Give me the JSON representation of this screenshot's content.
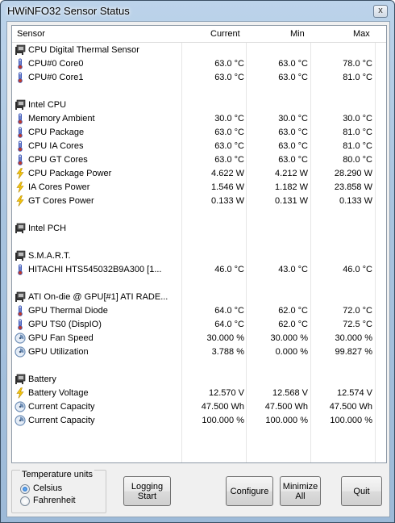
{
  "window": {
    "title": "HWiNFO32 Sensor Status",
    "close_label": "x"
  },
  "columns": {
    "sensor": "Sensor",
    "current": "Current",
    "min": "Min",
    "max": "Max"
  },
  "rows": [
    {
      "kind": "group",
      "label": "CPU Digital Thermal Sensor",
      "icon": "chip-icon"
    },
    {
      "kind": "sensor",
      "label": "CPU#0 Core0",
      "current": "63.0 °C",
      "min": "63.0 °C",
      "max": "78.0 °C",
      "icon": "thermometer-icon"
    },
    {
      "kind": "sensor",
      "label": "CPU#0 Core1",
      "current": "63.0 °C",
      "min": "63.0 °C",
      "max": "81.0 °C",
      "icon": "thermometer-icon"
    },
    {
      "kind": "blank"
    },
    {
      "kind": "group",
      "label": "Intel CPU",
      "icon": "chip-icon"
    },
    {
      "kind": "sensor",
      "label": "Memory Ambient",
      "current": "30.0 °C",
      "min": "30.0 °C",
      "max": "30.0 °C",
      "icon": "thermometer-icon"
    },
    {
      "kind": "sensor",
      "label": "CPU Package",
      "current": "63.0 °C",
      "min": "63.0 °C",
      "max": "81.0 °C",
      "icon": "thermometer-icon"
    },
    {
      "kind": "sensor",
      "label": "CPU IA Cores",
      "current": "63.0 °C",
      "min": "63.0 °C",
      "max": "81.0 °C",
      "icon": "thermometer-icon"
    },
    {
      "kind": "sensor",
      "label": "CPU GT Cores",
      "current": "63.0 °C",
      "min": "63.0 °C",
      "max": "80.0 °C",
      "icon": "thermometer-icon"
    },
    {
      "kind": "sensor",
      "label": "CPU Package Power",
      "current": "4.622 W",
      "min": "4.212 W",
      "max": "28.290 W",
      "icon": "lightning-icon"
    },
    {
      "kind": "sensor",
      "label": "IA Cores Power",
      "current": "1.546 W",
      "min": "1.182 W",
      "max": "23.858 W",
      "icon": "lightning-icon"
    },
    {
      "kind": "sensor",
      "label": "GT Cores Power",
      "current": "0.133 W",
      "min": "0.131 W",
      "max": "0.133 W",
      "icon": "lightning-icon"
    },
    {
      "kind": "blank"
    },
    {
      "kind": "group",
      "label": "Intel PCH",
      "icon": "chip-icon"
    },
    {
      "kind": "blank"
    },
    {
      "kind": "group",
      "label": "S.M.A.R.T.",
      "icon": "chip-icon"
    },
    {
      "kind": "sensor",
      "label": "HITACHI HTS545032B9A300 [1...",
      "current": "46.0 °C",
      "min": "43.0 °C",
      "max": "46.0 °C",
      "icon": "thermometer-icon"
    },
    {
      "kind": "blank"
    },
    {
      "kind": "group",
      "label": "ATI On-die @ GPU[#1] ATI RADE...",
      "icon": "chip-icon"
    },
    {
      "kind": "sensor",
      "label": "GPU Thermal Diode",
      "current": "64.0 °C",
      "min": "62.0 °C",
      "max": "72.0 °C",
      "icon": "thermometer-icon"
    },
    {
      "kind": "sensor",
      "label": "GPU TS0 (DispIO)",
      "current": "64.0 °C",
      "min": "62.0 °C",
      "max": "72.5 °C",
      "icon": "thermometer-icon"
    },
    {
      "kind": "sensor",
      "label": "GPU Fan Speed",
      "current": "30.000 %",
      "min": "30.000 %",
      "max": "30.000 %",
      "icon": "gauge-icon"
    },
    {
      "kind": "sensor",
      "label": "GPU Utilization",
      "current": "3.788 %",
      "min": "0.000 %",
      "max": "99.827 %",
      "icon": "gauge-icon"
    },
    {
      "kind": "blank"
    },
    {
      "kind": "group",
      "label": "Battery",
      "icon": "chip-icon"
    },
    {
      "kind": "sensor",
      "label": "Battery Voltage",
      "current": "12.570 V",
      "min": "12.568 V",
      "max": "12.574 V",
      "icon": "lightning-icon"
    },
    {
      "kind": "sensor",
      "label": "Current Capacity",
      "current": "47.500 Wh",
      "min": "47.500 Wh",
      "max": "47.500 Wh",
      "icon": "gauge-icon"
    },
    {
      "kind": "sensor",
      "label": "Current Capacity",
      "current": "100.000 %",
      "min": "100.000 %",
      "max": "100.000 %",
      "icon": "gauge-icon"
    }
  ],
  "temperature_units": {
    "legend": "Temperature units",
    "options": [
      "Celsius",
      "Fahrenheit"
    ],
    "selected": "Celsius"
  },
  "buttons": {
    "logging": "Logging\nStart",
    "configure": "Configure",
    "minimize": "Minimize\nAll",
    "quit": "Quit"
  },
  "colors": {
    "thermometer": "#3a56b8",
    "thermometer_bulb": "#c0392b",
    "lightning": "#f2c40f",
    "gauge": "#6f8fb7"
  }
}
